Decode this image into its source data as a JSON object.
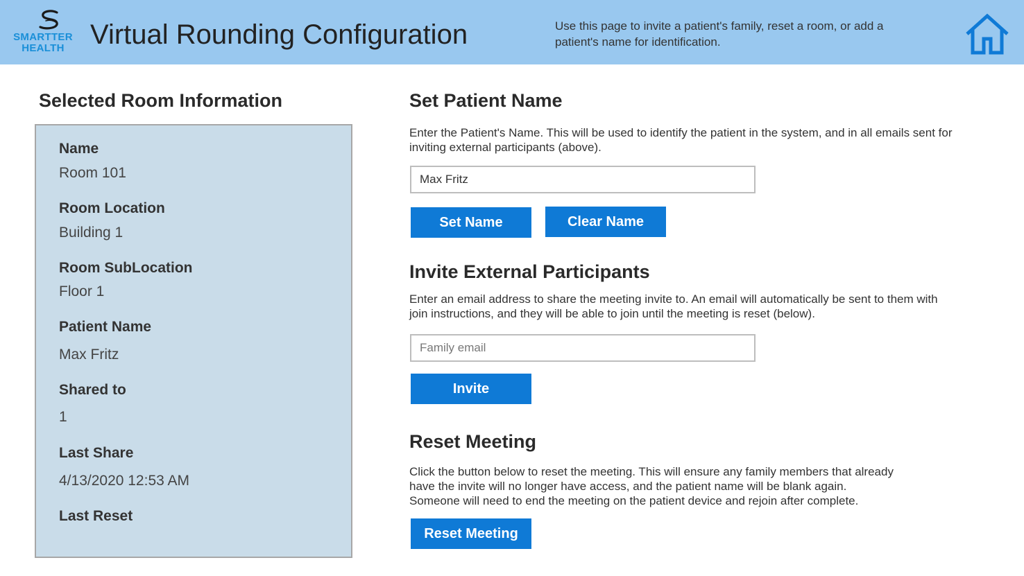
{
  "header": {
    "logo_text_line1": "SMARTTER",
    "logo_text_line2": "HEALTH",
    "title": "Virtual Rounding Configuration",
    "description": "Use this page to invite a patient's family, reset a room, or add a patient's name for identification."
  },
  "colors": {
    "header_bg": "#99c8ef",
    "accent": "#0f7ad6",
    "panel_bg": "#c9dce9",
    "logo": "#1a8fd8"
  },
  "room_info": {
    "title": "Selected Room Information",
    "fields": [
      {
        "label": "Name",
        "value": "Room 101"
      },
      {
        "label": "Room Location",
        "value": "Building 1"
      },
      {
        "label": "Room SubLocation",
        "value": "Floor 1"
      },
      {
        "label": "Patient Name",
        "value": "Max Fritz"
      },
      {
        "label": "Shared to",
        "value": "1"
      },
      {
        "label": "Last Share",
        "value": "4/13/2020 12:53 AM"
      },
      {
        "label": "Last Reset",
        "value": ""
      }
    ]
  },
  "set_patient_name": {
    "title": "Set Patient Name",
    "description": "Enter the Patient's Name. This will be used to identify the patient in the system, and in all emails sent for inviting external participants (above).",
    "input_value": "Max Fritz",
    "set_button": "Set Name",
    "clear_button": "Clear Name"
  },
  "invite": {
    "title": "Invite External Participants",
    "description": "Enter an email address to share the meeting invite to. An email will automatically be sent to them with join instructions, and they will be able to join until the meeting is reset (below).",
    "placeholder": "Family email",
    "button": "Invite"
  },
  "reset": {
    "title": "Reset Meeting",
    "description_lines": [
      "Click the button below to reset the meeting. This will ensure any family members that already",
      "have the invite will no longer have access, and the patient name will be blank again.",
      "Someone will need to end the meeting on the patient device and rejoin after complete."
    ],
    "button": "Reset Meeting"
  },
  "icons": {
    "logo": "smarter-health-logo",
    "home": "home-icon"
  }
}
